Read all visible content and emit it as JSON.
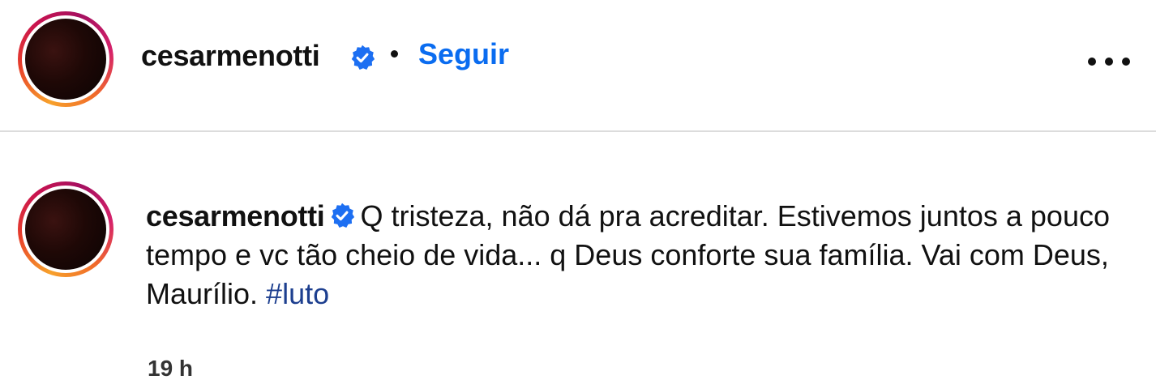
{
  "post": {
    "author": {
      "username": "cesarmenotti",
      "verified": true
    },
    "separator": "•",
    "follow_label": "Seguir",
    "more_icon": "more-horizontal-icon"
  },
  "comment": {
    "username": "cesarmenotti",
    "verified": true,
    "text": "Q tristeza, não dá pra acreditar. Estivemos juntos a pouco tempo e vc tão cheio de vida... q Deus conforte sua família. Vai com Deus, Maurílio. ",
    "hashtag": "#luto",
    "time_ago": "19 h"
  },
  "colors": {
    "follow_blue": "#0a6cf0",
    "verified_blue": "#1d6ff2",
    "hashtag_blue": "#1d3f8f",
    "divider": "#dcdcdc"
  }
}
